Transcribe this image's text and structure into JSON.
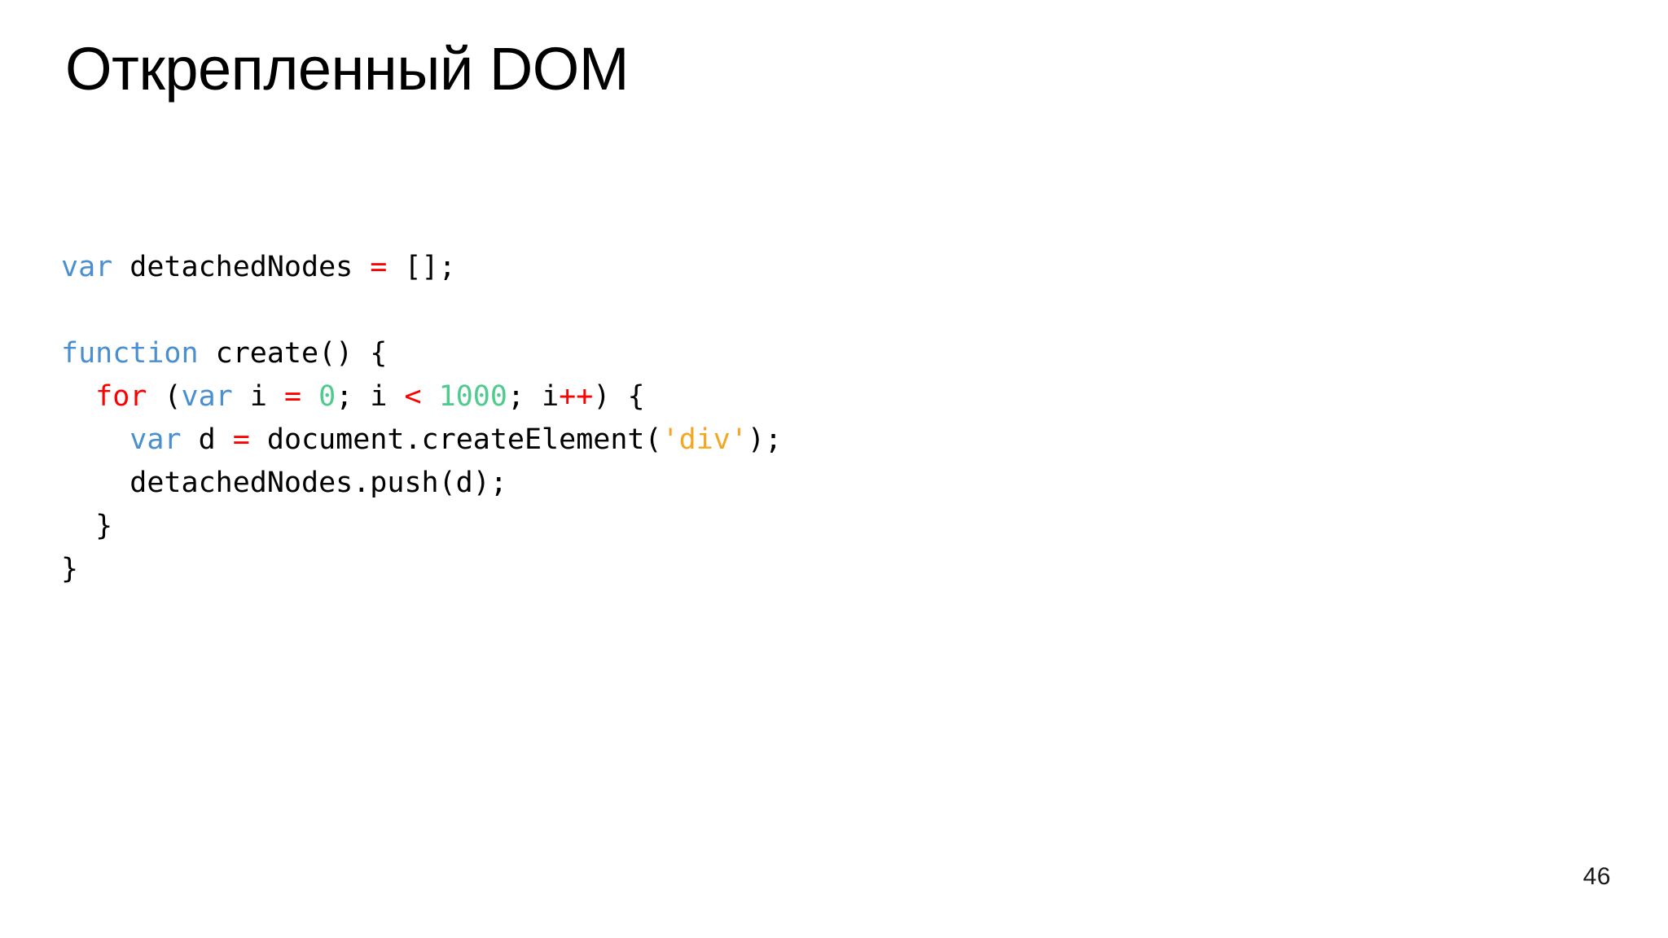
{
  "slide": {
    "title": "Открепленный DOM",
    "page_number": "46",
    "background_color": "#ffffff"
  },
  "theme": {
    "plain": "#000000",
    "keyword": "#4a8fd0",
    "identifier": "#4a90d9",
    "operator": "#ff0000",
    "number": "#4ecb8d",
    "string": "#f5a623",
    "control": "#ff0000"
  },
  "code": {
    "language": "javascript",
    "lines": [
      {
        "indent": 0,
        "text": "var detachedNodes = [];",
        "tokens": [
          {
            "t": "var",
            "c": "keyword"
          },
          {
            "t": " detachedNodes ",
            "c": "plain"
          },
          {
            "t": "=",
            "c": "operator"
          },
          {
            "t": " [];",
            "c": "plain"
          }
        ]
      },
      {
        "indent": 0,
        "text": "",
        "tokens": []
      },
      {
        "indent": 0,
        "text": "function create() {",
        "tokens": [
          {
            "t": "function",
            "c": "keyword"
          },
          {
            "t": " create() {",
            "c": "plain"
          }
        ]
      },
      {
        "indent": 1,
        "text": "  for (var i = 0; i < 1000; i++) {",
        "tokens": [
          {
            "t": "  ",
            "c": "plain"
          },
          {
            "t": "for",
            "c": "control"
          },
          {
            "t": " (",
            "c": "plain"
          },
          {
            "t": "var",
            "c": "keyword"
          },
          {
            "t": " i ",
            "c": "plain"
          },
          {
            "t": "=",
            "c": "operator"
          },
          {
            "t": " ",
            "c": "plain"
          },
          {
            "t": "0",
            "c": "number"
          },
          {
            "t": "; i ",
            "c": "plain"
          },
          {
            "t": "<",
            "c": "operator"
          },
          {
            "t": " ",
            "c": "plain"
          },
          {
            "t": "1000",
            "c": "number"
          },
          {
            "t": "; i",
            "c": "plain"
          },
          {
            "t": "++",
            "c": "operator"
          },
          {
            "t": ") {",
            "c": "plain"
          }
        ]
      },
      {
        "indent": 2,
        "text": "    var d = document.createElement('div');",
        "tokens": [
          {
            "t": "    ",
            "c": "plain"
          },
          {
            "t": "var",
            "c": "keyword"
          },
          {
            "t": " d ",
            "c": "plain"
          },
          {
            "t": "=",
            "c": "operator"
          },
          {
            "t": " ",
            "c": "plain"
          },
          {
            "t": "document",
            "c": "identifier"
          },
          {
            "t": ".",
            "c": "identifier"
          },
          {
            "t": "createElement",
            "c": "identifier"
          },
          {
            "t": "(",
            "c": "plain"
          },
          {
            "t": "'div'",
            "c": "string"
          },
          {
            "t": ");",
            "c": "plain"
          }
        ]
      },
      {
        "indent": 2,
        "text": "    detachedNodes.push(d);",
        "tokens": [
          {
            "t": "    detachedNodes.",
            "c": "plain"
          },
          {
            "t": "push",
            "c": "identifier"
          },
          {
            "t": "(d);",
            "c": "plain"
          }
        ]
      },
      {
        "indent": 1,
        "text": "  }",
        "tokens": [
          {
            "t": "  }",
            "c": "plain"
          }
        ]
      },
      {
        "indent": 0,
        "text": "}",
        "tokens": [
          {
            "t": "}",
            "c": "plain"
          }
        ]
      }
    ]
  }
}
